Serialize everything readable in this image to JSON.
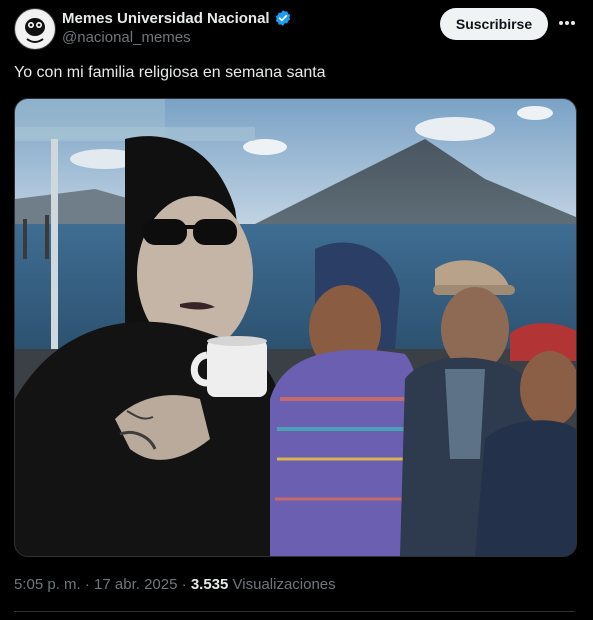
{
  "account": {
    "display_name": "Memes Universidad Nacional",
    "handle": "@nacional_memes",
    "verified_color": "#1d9bf0"
  },
  "actions": {
    "follow_label": "Suscribirse",
    "more_icon": "more-horizontal-icon"
  },
  "tweet": {
    "text": "Yo con mi familia religiosa en semana santa"
  },
  "meta": {
    "time": "5:05 p. m.",
    "sep1": "·",
    "date": "17 abr. 2025",
    "sep2": "·",
    "views_count": "3.535",
    "views_label": "Visualizaciones"
  }
}
